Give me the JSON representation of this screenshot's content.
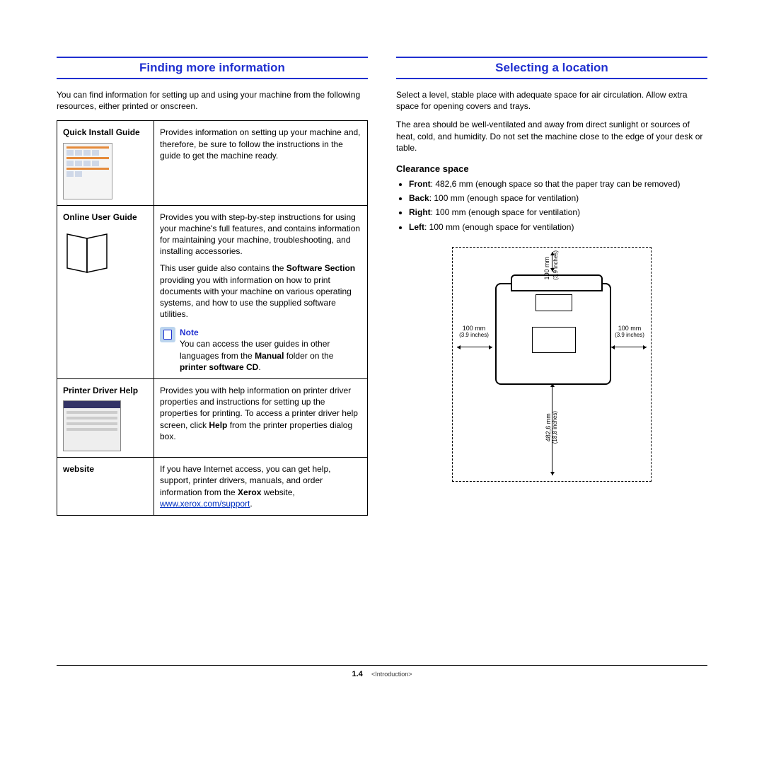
{
  "left": {
    "heading": "Finding more information",
    "intro": "You can find information for setting up and using your machine from the following resources, either printed or onscreen.",
    "rows": {
      "quick": {
        "label": "Quick Install Guide",
        "desc": "Provides information on setting up your machine and, therefore, be sure to follow the instructions in the guide to get the machine ready."
      },
      "online": {
        "label": "Online User Guide",
        "desc1": "Provides you with step-by-step instructions for using your machine's full features, and contains information for maintaining your machine, troubleshooting, and installing accessories.",
        "desc2a": "This user guide also contains the ",
        "desc2b": "Software Section",
        "desc2c": " providing you with information on how to print documents with your machine on various operating systems, and how to use the supplied software utilities.",
        "note_label": "Note",
        "note_a": "You can access the user guides in other languages from the ",
        "note_b": "Manual",
        "note_c": " folder on the ",
        "note_d": "printer software CD",
        "note_e": "."
      },
      "driver": {
        "label": "Printer Driver Help",
        "desc_a": "Provides you with help information on printer driver properties and instructions for setting up the properties for printing. To access a printer driver help screen, click ",
        "desc_b": "Help",
        "desc_c": " from the printer properties dialog box."
      },
      "website": {
        "label": "website",
        "desc_a": "If you have Internet access, you can get help, support, printer drivers, manuals, and order information from the ",
        "desc_b": "Xerox",
        "desc_c": " website, ",
        "link": "www.xerox.com/support",
        "desc_d": "."
      }
    }
  },
  "right": {
    "heading": "Selecting a location",
    "p1": "Select a level, stable place with adequate space for air circulation. Allow extra space for opening covers and trays.",
    "p2": "The area should be well-ventilated and away from direct sunlight or sources of heat, cold, and humidity. Do not set the machine close to the edge of your desk or table.",
    "sub": "Clearance space",
    "items": {
      "front": {
        "k": "Front",
        "v": ": 482,6 mm (enough space so that the paper tray can be removed)"
      },
      "back": {
        "k": "Back",
        "v": ": 100 mm (enough space for ventilation)"
      },
      "rightside": {
        "k": "Right",
        "v": ": 100 mm (enough space for ventilation)"
      },
      "leftside": {
        "k": "Left",
        "v": ": 100 mm (enough space for ventilation)"
      }
    },
    "dims": {
      "top_mm": "100 mm",
      "top_in": "(3.9 inches)",
      "left_mm": "100 mm",
      "left_in": "(3.9 inches)",
      "right_mm": "100 mm",
      "right_in": "(3.9 inches)",
      "front_mm": "482,6 mm",
      "front_in": "(18,8 inches)"
    }
  },
  "footer": {
    "page": "1.4",
    "chapter": "<Introduction>"
  }
}
